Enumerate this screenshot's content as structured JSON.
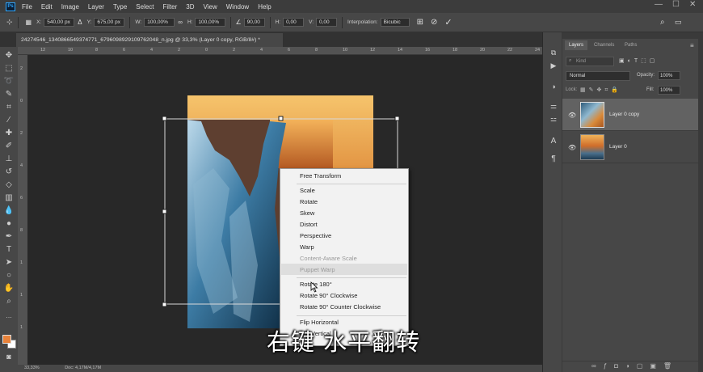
{
  "app": {
    "logo": "Ps"
  },
  "menu": [
    "File",
    "Edit",
    "Image",
    "Layer",
    "Type",
    "Select",
    "Filter",
    "3D",
    "View",
    "Window",
    "Help"
  ],
  "options": {
    "x_label": "X:",
    "x_value": "540,00 px",
    "y_label": "Y:",
    "y_value": "675,00 px",
    "w_label": "W:",
    "w_value": "100,00%",
    "h_label": "H:",
    "h_value": "100,00%",
    "angle_value": "90,00",
    "hskew_label": "H:",
    "hskew_value": "0,00",
    "vskew_label": "V:",
    "vskew_value": "0,00",
    "interp_label": "Interpolation:",
    "interp_value": "Bicubic"
  },
  "document_tab": "24274546_1340866549374771_6796098929109762048_n.jpg @ 33,3% (Layer 0 copy, RGB/8#) *",
  "rulers": {
    "top": [
      "12",
      "10",
      "8",
      "6",
      "4",
      "2",
      "0",
      "2",
      "4",
      "6",
      "8",
      "10",
      "12",
      "14",
      "16",
      "18",
      "20",
      "22",
      "24"
    ],
    "left": [
      "2",
      "0",
      "2",
      "4",
      "6",
      "8",
      "1",
      "1",
      "1"
    ]
  },
  "status": {
    "zoom": "33,33%",
    "doc": "Doc: 4,17M/4,17M"
  },
  "layers_panel": {
    "tabs": [
      "Layers",
      "Channels",
      "Paths"
    ],
    "kind_label": "Kind",
    "blend_mode": "Normal",
    "opacity_label": "Opacity:",
    "opacity_value": "100%",
    "lock_label": "Lock:",
    "fill_label": "Fill:",
    "fill_value": "100%",
    "layers": [
      {
        "name": "Layer 0 copy",
        "selected": true
      },
      {
        "name": "Layer 0",
        "selected": false
      }
    ]
  },
  "context_menu": {
    "items": [
      {
        "label": "Free Transform",
        "disabled": false
      },
      {
        "label": "Scale",
        "disabled": false
      },
      {
        "label": "Rotate",
        "disabled": false
      },
      {
        "label": "Skew",
        "disabled": false
      },
      {
        "label": "Distort",
        "disabled": false
      },
      {
        "label": "Perspective",
        "disabled": false
      },
      {
        "label": "Warp",
        "disabled": false
      },
      {
        "label": "Content-Aware Scale",
        "disabled": true
      },
      {
        "label": "Puppet Warp",
        "disabled": true
      },
      {
        "label": "Rotate 180°",
        "disabled": false
      },
      {
        "label": "Rotate 90° Clockwise",
        "disabled": false
      },
      {
        "label": "Rotate 90° Counter Clockwise",
        "disabled": false
      },
      {
        "label": "Flip Horizontal",
        "disabled": false
      },
      {
        "label": "Flip Vertical",
        "disabled": false
      }
    ]
  },
  "caption": "右键 水平翻转",
  "colors": {
    "foreground": "#e8823a",
    "background": "#ffffff",
    "accent": "#31a8ff"
  }
}
